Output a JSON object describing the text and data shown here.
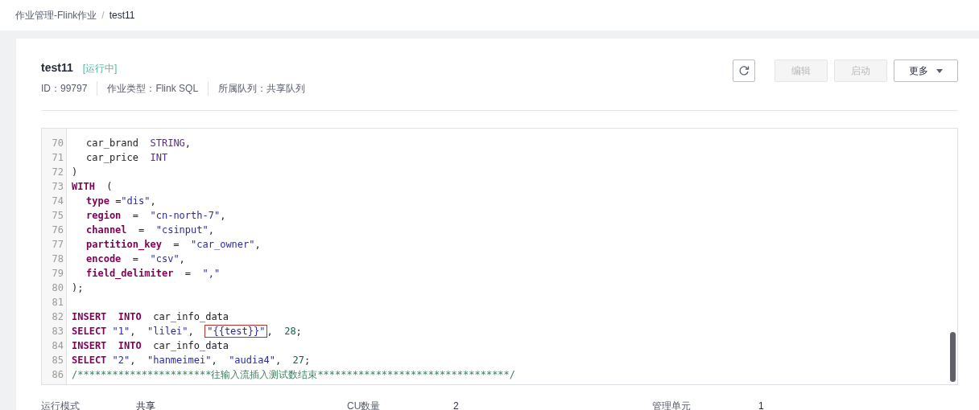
{
  "breadcrumb_separator": "/",
  "breadcrumb": [
    {
      "label": "作业管理-Flink作业",
      "current": false
    },
    {
      "label": "test11",
      "current": true
    }
  ],
  "job": {
    "name": "test11",
    "status": "[运行中]",
    "meta": [
      "ID：99797",
      "作业类型：Flink SQL",
      "所属队列：共享队列"
    ]
  },
  "actions": [
    {
      "kind": "refresh",
      "disabled": false
    },
    {
      "kind": "text",
      "label": "编辑",
      "disabled": true
    },
    {
      "kind": "text",
      "label": "启动",
      "disabled": true
    },
    {
      "kind": "dropdown",
      "label": "更多",
      "disabled": false
    }
  ],
  "editor": {
    "lines": [
      {
        "num": "70",
        "indented": true,
        "tokens": [
          {
            "kind": "plain",
            "text": "car_brand  "
          },
          {
            "kind": "type",
            "text": "STRING"
          },
          {
            "kind": "plain",
            "text": ","
          }
        ]
      },
      {
        "num": "71",
        "indented": true,
        "tokens": [
          {
            "kind": "plain",
            "text": "car_price  "
          },
          {
            "kind": "type",
            "text": "INT"
          }
        ]
      },
      {
        "num": "72",
        "tokens": [
          {
            "kind": "plain",
            "text": ")"
          }
        ]
      },
      {
        "num": "73",
        "tokens": [
          {
            "kind": "keyword",
            "text": "WITH"
          },
          {
            "kind": "plain",
            "text": "  ("
          }
        ]
      },
      {
        "num": "74",
        "indented": true,
        "tokens": [
          {
            "kind": "keyword",
            "text": "type"
          },
          {
            "kind": "plain",
            "text": " ="
          },
          {
            "kind": "string",
            "text": "\"dis\""
          },
          {
            "kind": "plain",
            "text": ","
          }
        ]
      },
      {
        "num": "75",
        "indented": true,
        "tokens": [
          {
            "kind": "keyword",
            "text": "region"
          },
          {
            "kind": "plain",
            "text": "  =  "
          },
          {
            "kind": "string",
            "text": "\"cn-north-7\""
          },
          {
            "kind": "plain",
            "text": ","
          }
        ]
      },
      {
        "num": "76",
        "indented": true,
        "tokens": [
          {
            "kind": "keyword",
            "text": "channel"
          },
          {
            "kind": "plain",
            "text": "  =  "
          },
          {
            "kind": "string",
            "text": "\"csinput\""
          },
          {
            "kind": "plain",
            "text": ","
          }
        ]
      },
      {
        "num": "77",
        "indented": true,
        "tokens": [
          {
            "kind": "keyword",
            "text": "partition_key"
          },
          {
            "kind": "plain",
            "text": "  =  "
          },
          {
            "kind": "string",
            "text": "\"car_owner\""
          },
          {
            "kind": "plain",
            "text": ","
          }
        ]
      },
      {
        "num": "78",
        "indented": true,
        "tokens": [
          {
            "kind": "keyword",
            "text": "encode"
          },
          {
            "kind": "plain",
            "text": "  =  "
          },
          {
            "kind": "string",
            "text": "\"csv\""
          },
          {
            "kind": "plain",
            "text": ","
          }
        ]
      },
      {
        "num": "79",
        "indented": true,
        "tokens": [
          {
            "kind": "keyword",
            "text": "field_delimiter"
          },
          {
            "kind": "plain",
            "text": "  =  "
          },
          {
            "kind": "string",
            "text": "\",\""
          }
        ]
      },
      {
        "num": "80",
        "tokens": [
          {
            "kind": "plain",
            "text": ");"
          }
        ]
      },
      {
        "num": "81"
      },
      {
        "num": "82",
        "tokens": [
          {
            "kind": "keyword",
            "text": "INSERT  "
          },
          {
            "kind": "keyword",
            "text": "INTO"
          },
          {
            "kind": "plain",
            "text": "  car_info_data"
          }
        ]
      },
      {
        "num": "83",
        "tokens": [
          {
            "kind": "keyword",
            "text": "SELECT "
          },
          {
            "kind": "string",
            "text": "\"1\""
          },
          {
            "kind": "plain",
            "text": ",  "
          },
          {
            "kind": "string",
            "text": "\"lilei\""
          },
          {
            "kind": "plain",
            "text": ",  "
          },
          {
            "kind": "marked",
            "text": "\"{{test}}\""
          },
          {
            "kind": "plain",
            "text": ",  "
          },
          {
            "kind": "number",
            "text": "28"
          },
          {
            "kind": "plain",
            "text": ";"
          }
        ]
      },
      {
        "num": "84",
        "tokens": [
          {
            "kind": "keyword",
            "text": "INSERT  "
          },
          {
            "kind": "keyword",
            "text": "INTO"
          },
          {
            "kind": "plain",
            "text": "  car_info_data"
          }
        ]
      },
      {
        "num": "85",
        "tokens": [
          {
            "kind": "keyword",
            "text": "SELECT "
          },
          {
            "kind": "string",
            "text": "\"2\""
          },
          {
            "kind": "plain",
            "text": ",  "
          },
          {
            "kind": "string",
            "text": "\"hanmeimei\""
          },
          {
            "kind": "plain",
            "text": ",  "
          },
          {
            "kind": "string",
            "text": "\"audia4\""
          },
          {
            "kind": "plain",
            "text": ",  "
          },
          {
            "kind": "number",
            "text": "27"
          },
          {
            "kind": "plain",
            "text": ";"
          }
        ]
      },
      {
        "num": "86",
        "tokens": [
          {
            "kind": "comment",
            "text": "/***********************往输入流插入测试数结束*********************************/"
          }
        ]
      }
    ]
  },
  "details": [
    {
      "label": "运行模式",
      "value": "共享"
    },
    {
      "label": "CU数量",
      "value": "2"
    },
    {
      "label": "管理单元",
      "value": "1"
    }
  ]
}
